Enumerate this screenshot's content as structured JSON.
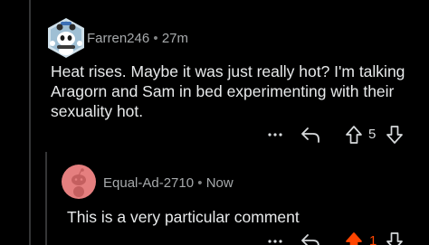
{
  "comment": {
    "username": "Farren246",
    "separator": "•",
    "timestamp": "27m",
    "body": "Heat rises. Maybe it was just really hot? I'm talking Aragorn and Sam in bed experimenting with their sexuality hot.",
    "vote_count": "5",
    "avatar_icon": "snoo-avatar-icon"
  },
  "reply": {
    "username": "Equal-Ad-2710",
    "separator": "•",
    "timestamp": "Now",
    "body": "This is a very particular comment",
    "vote_count": "1",
    "upvote_color": "#ff4500",
    "avatar_color": "#e57f7f"
  },
  "colors": {
    "background": "#000000",
    "text": "#e8eaeb",
    "meta": "#a6a9ab",
    "thread_line": "#343536",
    "upvoted": "#ff4500"
  }
}
